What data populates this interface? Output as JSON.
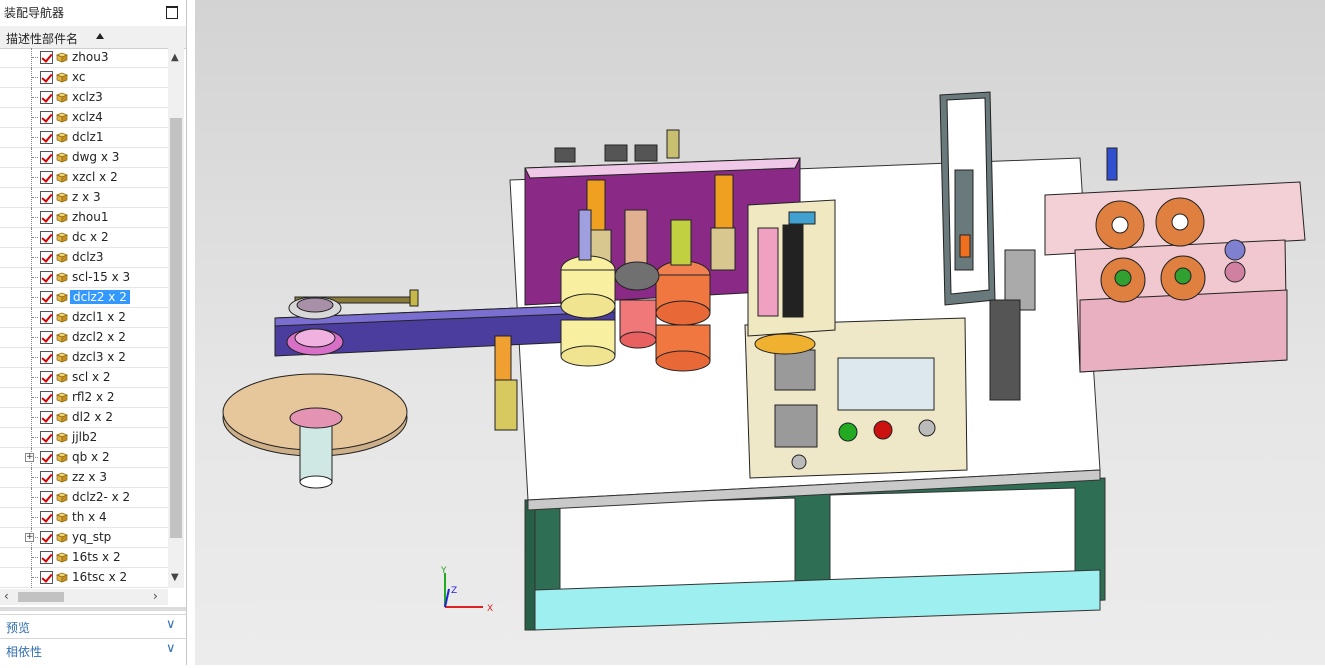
{
  "navigator": {
    "title": "装配导航器",
    "column_header": "描述性部件名",
    "items": [
      {
        "label": "zhou3"
      },
      {
        "label": "xc"
      },
      {
        "label": "xclz3"
      },
      {
        "label": "xclz4"
      },
      {
        "label": "dclz1"
      },
      {
        "label": "dwg x 3"
      },
      {
        "label": "xzcl x 2"
      },
      {
        "label": "z x 3"
      },
      {
        "label": "zhou1"
      },
      {
        "label": "dc x 2"
      },
      {
        "label": "dclz3"
      },
      {
        "label": "scl-15 x 3"
      },
      {
        "label": "dclz2 x 2",
        "selected": true
      },
      {
        "label": "dzcl1 x 2"
      },
      {
        "label": "dzcl2 x 2"
      },
      {
        "label": "dzcl3 x 2"
      },
      {
        "label": "scl x 2"
      },
      {
        "label": "rfl2 x 2"
      },
      {
        "label": "dl2 x 2"
      },
      {
        "label": "jjlb2"
      },
      {
        "label": "qb x 2",
        "expandable": true
      },
      {
        "label": "zz x 3"
      },
      {
        "label": "dclz2- x 2"
      },
      {
        "label": "th x 4"
      },
      {
        "label": "yq_stp",
        "expandable": true
      },
      {
        "label": "16ts x 2"
      },
      {
        "label": "16tsc x 2"
      }
    ]
  },
  "panels": {
    "preview": "预览",
    "dependency": "相依性"
  },
  "colors": {
    "selection": "#3399ff",
    "panel_text": "#2f6fb0",
    "check_mark": "#d40000",
    "viewport_bg": "#dedede"
  },
  "icons": {
    "maximize": "maximize-icon",
    "sort": "sort-ascending-icon",
    "checkbox": "checked-checkbox-icon",
    "component": "component-cube-icon",
    "expand": "expand-plus-icon",
    "collapse_panel": "chevron-down-icon"
  }
}
